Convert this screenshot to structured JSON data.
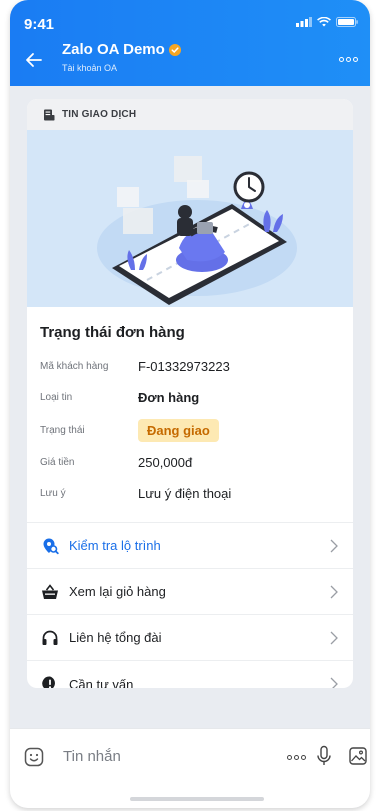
{
  "status_bar": {
    "time": "9:41"
  },
  "header": {
    "title": "Zalo OA Demo",
    "subtitle": "Tài khoản OA"
  },
  "card": {
    "section_label": "TIN GIAO DỊCH",
    "order_title": "Trạng thái đơn hàng",
    "fields": [
      {
        "key": "Mã khách hàng",
        "value": "F-01332973223"
      },
      {
        "key": "Loại tin",
        "value": "Đơn hàng"
      },
      {
        "key": "Trạng thái",
        "value": "Đang giao"
      },
      {
        "key": "Giá tiền",
        "value": "250,000đ"
      },
      {
        "key": "Lưu ý",
        "value": "Lưu ý điện thoại"
      }
    ],
    "actions": [
      {
        "label": "Kiểm tra lộ trình",
        "icon": "location-search-icon"
      },
      {
        "label": "Xem lại giỏ hàng",
        "icon": "basket-icon"
      },
      {
        "label": "Liên hệ tổng đài",
        "icon": "headphones-icon"
      },
      {
        "label": "Cần tư vấn",
        "icon": "chat-alert-icon"
      }
    ]
  },
  "composer": {
    "placeholder": "Tin nhắn"
  },
  "colors": {
    "header": "#1a7cf3",
    "link": "#1a6fe8",
    "badge_bg": "#fde9b3",
    "badge_text": "#c56a00"
  }
}
